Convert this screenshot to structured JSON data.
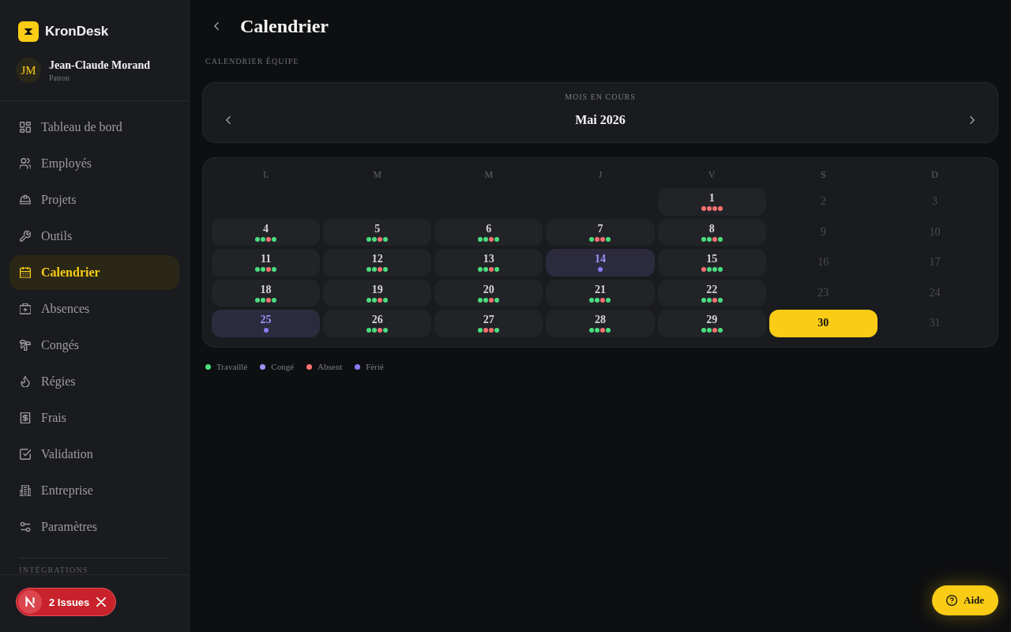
{
  "sidebar": {
    "brand": {
      "name": "KronDesk"
    },
    "user": {
      "initials": "JM",
      "name": "Jean-Claude Morand",
      "role": "Patron"
    },
    "nav": [
      {
        "label": "Tableau de bord",
        "selected": false
      },
      {
        "label": "Employés",
        "selected": false
      },
      {
        "label": "Projets",
        "selected": false
      },
      {
        "label": "Outils",
        "selected": false
      },
      {
        "label": "Calendrier",
        "selected": true
      },
      {
        "label": "Absences",
        "selected": false
      },
      {
        "label": "Congés",
        "selected": false
      },
      {
        "label": "Régies",
        "selected": false
      },
      {
        "label": "Frais",
        "selected": false
      },
      {
        "label": "Validation",
        "selected": false
      },
      {
        "label": "Entreprise",
        "selected": false
      },
      {
        "label": "Paramètres",
        "selected": false
      }
    ],
    "section_label": "INTÉGRATIONS"
  },
  "dev_indicator": {
    "label": "2 Issues"
  },
  "header": {
    "title": "Calendrier"
  },
  "section_label": "CALENDRIER ÉQUIPE",
  "month": {
    "caption": "MOIS EN COURS",
    "label": "Mai 2026"
  },
  "calendar": {
    "weekdays": [
      "L",
      "M",
      "M",
      "J",
      "V",
      "S",
      "D"
    ],
    "weeks": [
      [
        {
          "kind": "empty"
        },
        {
          "kind": "empty"
        },
        {
          "kind": "empty"
        },
        {
          "kind": "empty"
        },
        {
          "day": "1",
          "kind": "workday",
          "selected": false,
          "dots": [
            {
              "color": "#f87171"
            },
            {
              "color": "#f87171"
            },
            {
              "color": "#f87171"
            },
            {
              "color": "#f87171"
            }
          ]
        },
        {
          "day": "2",
          "kind": "weekend",
          "selected": false
        },
        {
          "day": "3",
          "kind": "weekend",
          "selected": false
        }
      ],
      [
        {
          "day": "4",
          "kind": "workday",
          "selected": false,
          "dots": [
            {
              "color": "#4ade80"
            },
            {
              "color": "#4ade80"
            },
            {
              "color": "#f87171"
            },
            {
              "color": "#4ade80"
            }
          ]
        },
        {
          "day": "5",
          "kind": "workday",
          "selected": false,
          "dots": [
            {
              "color": "#4ade80"
            },
            {
              "color": "#4ade80"
            },
            {
              "color": "#f87171"
            },
            {
              "color": "#4ade80"
            }
          ]
        },
        {
          "day": "6",
          "kind": "workday",
          "selected": false,
          "dots": [
            {
              "color": "#4ade80"
            },
            {
              "color": "#4ade80"
            },
            {
              "color": "#f87171"
            },
            {
              "color": "#4ade80"
            }
          ]
        },
        {
          "day": "7",
          "kind": "workday",
          "selected": false,
          "dots": [
            {
              "color": "#4ade80"
            },
            {
              "color": "#f87171"
            },
            {
              "color": "#f87171"
            },
            {
              "color": "#4ade80"
            }
          ]
        },
        {
          "day": "8",
          "kind": "workday",
          "selected": false,
          "dots": [
            {
              "color": "#4ade80"
            },
            {
              "color": "#4ade80"
            },
            {
              "color": "#f87171"
            },
            {
              "color": "#4ade80"
            }
          ]
        },
        {
          "day": "9",
          "kind": "weekend",
          "selected": false
        },
        {
          "day": "10",
          "kind": "weekend",
          "selected": false
        }
      ],
      [
        {
          "day": "11",
          "kind": "workday",
          "selected": false,
          "dots": [
            {
              "color": "#4ade80"
            },
            {
              "color": "#4ade80"
            },
            {
              "color": "#f87171"
            },
            {
              "color": "#4ade80"
            }
          ]
        },
        {
          "day": "12",
          "kind": "workday",
          "selected": false,
          "dots": [
            {
              "color": "#4ade80"
            },
            {
              "color": "#4ade80"
            },
            {
              "color": "#f87171"
            },
            {
              "color": "#4ade80"
            }
          ]
        },
        {
          "day": "13",
          "kind": "workday",
          "selected": false,
          "dots": [
            {
              "color": "#4ade80"
            },
            {
              "color": "#4ade80"
            },
            {
              "color": "#f87171"
            },
            {
              "color": "#4ade80"
            }
          ]
        },
        {
          "day": "14",
          "kind": "holiday",
          "selected": false,
          "dots": [
            {
              "color": "#8b7cf6"
            }
          ]
        },
        {
          "day": "15",
          "kind": "workday",
          "selected": false,
          "dots": [
            {
              "color": "#f87171"
            },
            {
              "color": "#4ade80"
            },
            {
              "color": "#4ade80"
            },
            {
              "color": "#4ade80"
            }
          ]
        },
        {
          "day": "16",
          "kind": "weekend",
          "selected": false
        },
        {
          "day": "17",
          "kind": "weekend",
          "selected": false
        }
      ],
      [
        {
          "day": "18",
          "kind": "workday",
          "selected": false,
          "dots": [
            {
              "color": "#4ade80"
            },
            {
              "color": "#4ade80"
            },
            {
              "color": "#f87171"
            },
            {
              "color": "#4ade80"
            }
          ]
        },
        {
          "day": "19",
          "kind": "workday",
          "selected": false,
          "dots": [
            {
              "color": "#4ade80"
            },
            {
              "color": "#4ade80"
            },
            {
              "color": "#f87171"
            },
            {
              "color": "#4ade80"
            }
          ]
        },
        {
          "day": "20",
          "kind": "workday",
          "selected": false,
          "dots": [
            {
              "color": "#4ade80"
            },
            {
              "color": "#4ade80"
            },
            {
              "color": "#f87171"
            },
            {
              "color": "#4ade80"
            }
          ]
        },
        {
          "day": "21",
          "kind": "workday",
          "selected": false,
          "dots": [
            {
              "color": "#4ade80"
            },
            {
              "color": "#4ade80"
            },
            {
              "color": "#f87171"
            },
            {
              "color": "#4ade80"
            }
          ]
        },
        {
          "day": "22",
          "kind": "workday",
          "selected": false,
          "dots": [
            {
              "color": "#4ade80"
            },
            {
              "color": "#4ade80"
            },
            {
              "color": "#f87171"
            },
            {
              "color": "#4ade80"
            }
          ]
        },
        {
          "day": "23",
          "kind": "weekend",
          "selected": false
        },
        {
          "day": "24",
          "kind": "weekend",
          "selected": false
        }
      ],
      [
        {
          "day": "25",
          "kind": "holiday",
          "selected": false,
          "dots": [
            {
              "color": "#8b7cf6"
            }
          ]
        },
        {
          "day": "26",
          "kind": "workday",
          "selected": false,
          "dots": [
            {
              "color": "#4ade80"
            },
            {
              "color": "#4ade80"
            },
            {
              "color": "#f87171"
            },
            {
              "color": "#4ade80"
            }
          ]
        },
        {
          "day": "27",
          "kind": "workday",
          "selected": false,
          "dots": [
            {
              "color": "#4ade80"
            },
            {
              "color": "#f87171"
            },
            {
              "color": "#f87171"
            },
            {
              "color": "#4ade80"
            }
          ]
        },
        {
          "day": "28",
          "kind": "workday",
          "selected": false,
          "dots": [
            {
              "color": "#4ade80"
            },
            {
              "color": "#4ade80"
            },
            {
              "color": "#f87171"
            },
            {
              "color": "#4ade80"
            }
          ]
        },
        {
          "day": "29",
          "kind": "workday",
          "selected": false,
          "dots": [
            {
              "color": "#4ade80"
            },
            {
              "color": "#4ade80"
            },
            {
              "color": "#f87171"
            },
            {
              "color": "#4ade80"
            }
          ]
        },
        {
          "day": "30",
          "kind": "weekend",
          "selected": true
        },
        {
          "day": "31",
          "kind": "weekend",
          "selected": false
        }
      ]
    ]
  },
  "legend": [
    {
      "label": "Travaillé",
      "color": "#4ade80"
    },
    {
      "label": "Congé",
      "color": "#9d92f2"
    },
    {
      "label": "Absent",
      "color": "#f87171"
    },
    {
      "label": "Férié",
      "color": "#8b7cf6"
    }
  ],
  "help_button": {
    "label": "Aide"
  }
}
